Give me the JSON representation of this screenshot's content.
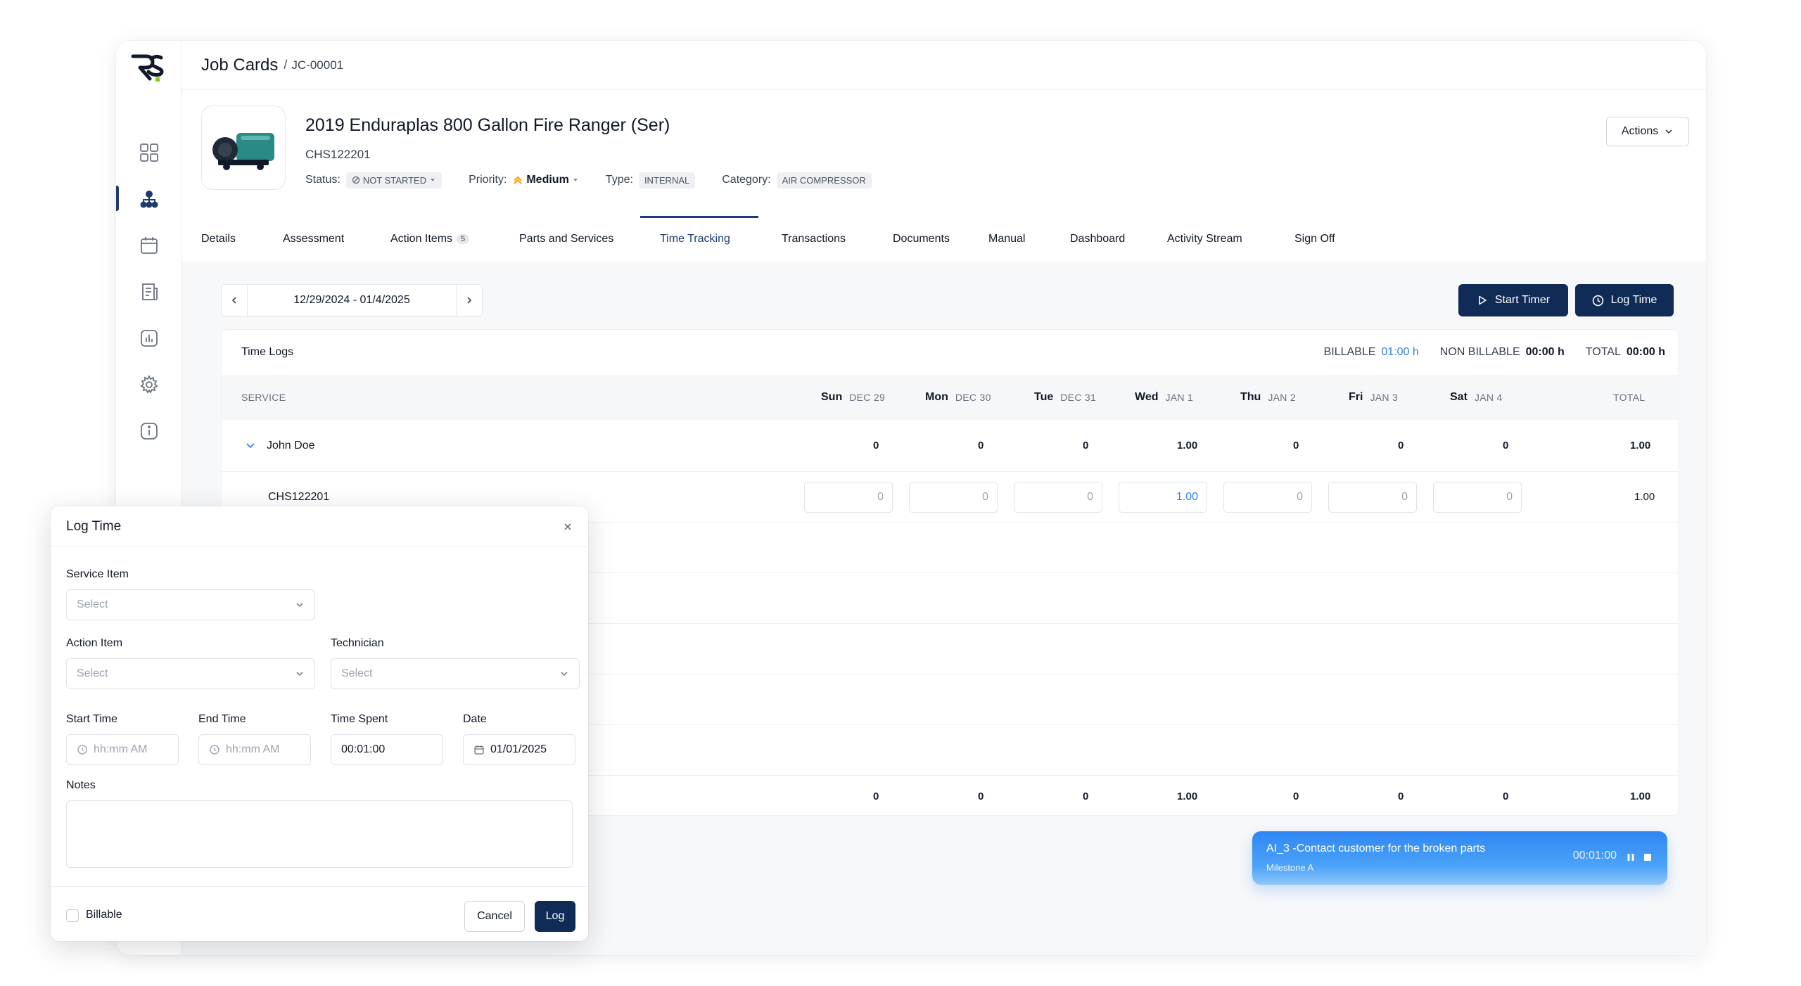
{
  "app": {
    "logo_text": "RS"
  },
  "sidebar": {
    "items": [
      {
        "icon": "dashboard-grid-icon"
      },
      {
        "icon": "hierarchy-icon",
        "active": true
      },
      {
        "icon": "calendar-icon"
      },
      {
        "icon": "document-icon"
      },
      {
        "icon": "report-icon"
      },
      {
        "icon": "settings-icon"
      },
      {
        "icon": "info-icon"
      }
    ]
  },
  "topbar": {
    "title": "Job Cards",
    "separator": "/",
    "crumb": "JC-00001"
  },
  "asset": {
    "title": "2019 Enduraplas 800 Gallon Fire Ranger (Ser)",
    "serial": "CHS122201",
    "status_label": "Status:",
    "status_value": "NOT STARTED",
    "priority_label": "Priority:",
    "priority_value": "Medium",
    "type_label": "Type:",
    "type_value": "INTERNAL",
    "category_label": "Category:",
    "category_value": "AIR COMPRESSOR",
    "actions_label": "Actions"
  },
  "tabs": [
    {
      "label": "Details"
    },
    {
      "label": "Assessment"
    },
    {
      "label": "Action Items",
      "badge": "5"
    },
    {
      "label": "Parts and Services"
    },
    {
      "label": "Time Tracking",
      "active": true
    },
    {
      "label": "Transactions"
    },
    {
      "label": "Documents"
    },
    {
      "label": "Manual"
    },
    {
      "label": "Dashboard"
    },
    {
      "label": "Activity Stream"
    },
    {
      "label": "Sign Off"
    }
  ],
  "toolbar": {
    "date_range": "12/29/2024 - 01/4/2025",
    "start_timer": "Start Timer",
    "log_time": "Log Time"
  },
  "time_logs": {
    "title": "Time Logs",
    "billable_label": "BILLABLE",
    "billable_value": "01:00 h",
    "non_billable_label": "NON BILLABLE",
    "non_billable_value": "00:00 h",
    "total_label": "TOTAL",
    "total_value": "00:00 h",
    "service_header": "SERVICE",
    "total_header": "TOTAL",
    "days": [
      {
        "day": "Sun",
        "date": "DEC 29"
      },
      {
        "day": "Mon",
        "date": "DEC 30"
      },
      {
        "day": "Tue",
        "date": "DEC 31"
      },
      {
        "day": "Wed",
        "date": "JAN 1"
      },
      {
        "day": "Thu",
        "date": "JAN 2"
      },
      {
        "day": "Fri",
        "date": "JAN 3"
      },
      {
        "day": "Sat",
        "date": "JAN 4"
      }
    ],
    "group": {
      "name": "John Doe",
      "values": [
        "0",
        "0",
        "0",
        "1.00",
        "0",
        "0",
        "0"
      ],
      "total": "1.00"
    },
    "entry": {
      "service": "CHS122201",
      "values": [
        "0",
        "0",
        "0",
        "1.00",
        "0",
        "0",
        "0"
      ],
      "total": "1.00"
    },
    "footer": {
      "values": [
        "0",
        "0",
        "0",
        "1.00",
        "0",
        "0",
        "0"
      ],
      "total": "1.00"
    }
  },
  "timer": {
    "title": "AI_3 -Contact customer for the broken parts",
    "subtitle": "Milestone A",
    "elapsed": "00:01:00"
  },
  "modal": {
    "title": "Log Time",
    "service_item_label": "Service Item",
    "service_item_placeholder": "Select",
    "action_item_label": "Action Item",
    "action_item_placeholder": "Select",
    "technician_label": "Technician",
    "technician_placeholder": "Select",
    "start_time_label": "Start Time",
    "start_time_placeholder": "hh:mm AM",
    "end_time_label": "End Time",
    "end_time_placeholder": "hh:mm AM",
    "time_spent_label": "Time Spent",
    "time_spent_value": "00:01:00",
    "date_label": "Date",
    "date_value": "01/01/2025",
    "notes_label": "Notes",
    "billable_label": "Billable",
    "billable_checked": false,
    "cancel_label": "Cancel",
    "log_label": "Log"
  },
  "colors": {
    "primary": "#102c56",
    "accent_blue": "#2f80ed",
    "priority_orange": "#f59e0b"
  }
}
